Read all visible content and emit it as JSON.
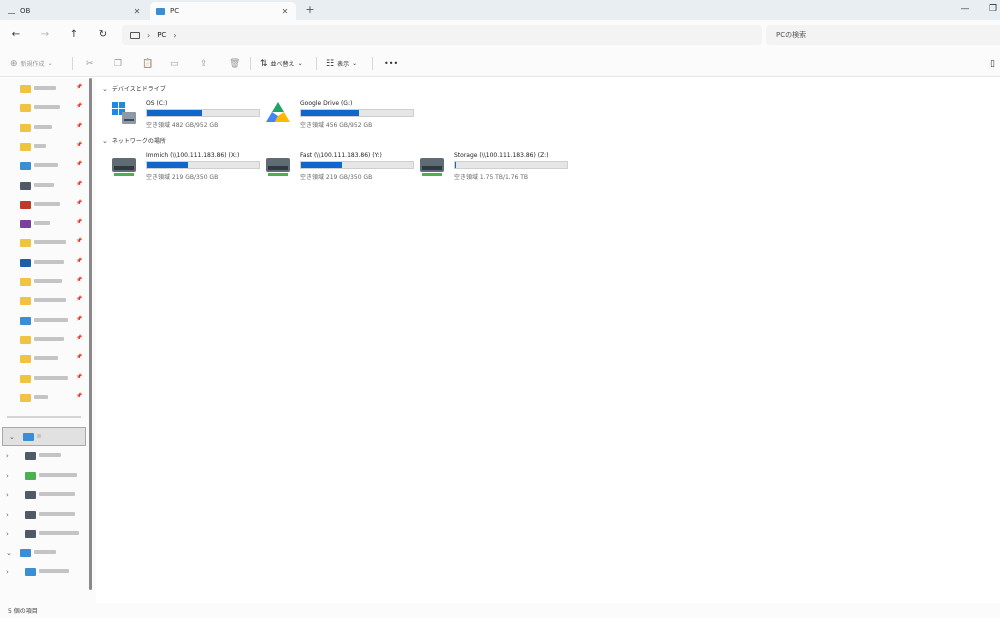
{
  "tabs": [
    {
      "title": "OB"
    },
    {
      "title": "PC"
    }
  ],
  "window": {
    "close_tab": "✕",
    "new_tab": "+",
    "minimize": "—",
    "maximize": "❐"
  },
  "address": {
    "computer_icon": "computer-icon",
    "separator": "›",
    "crumbs": [
      "PC"
    ],
    "search_placeholder": "PCの検索"
  },
  "commandbar": {
    "new_label": "新規作成",
    "sort_label": "並べ替え",
    "view_label": "表示",
    "more_label": "•••"
  },
  "navigation": {
    "quick_access": [
      {
        "color": "#f0c343"
      },
      {
        "color": "#f0c343"
      },
      {
        "color": "#f0c343"
      },
      {
        "color": "#f0c343"
      },
      {
        "color": "#3b8ed4"
      },
      {
        "color": "#505a66"
      },
      {
        "color": "#c0392b"
      },
      {
        "color": "#7b3fa0"
      },
      {
        "color": "#f0c343"
      },
      {
        "color": "#1d5fa8"
      },
      {
        "color": "#f0c343"
      },
      {
        "color": "#f0c343"
      },
      {
        "color": "#3b8ed4"
      },
      {
        "color": "#f0c343"
      },
      {
        "color": "#f0c343"
      },
      {
        "color": "#f0c343"
      },
      {
        "color": "#f0c343"
      }
    ],
    "this_pc": {
      "color": "#3b8ed4"
    },
    "network_drives": [
      {
        "color": "#505a66"
      },
      {
        "color": "#4caf50"
      },
      {
        "color": "#505a66"
      },
      {
        "color": "#505a66"
      },
      {
        "color": "#505a66"
      }
    ],
    "network": {
      "color": "#3b8ed4"
    },
    "network_child": {
      "color": "#3b8ed4"
    }
  },
  "content": {
    "devices_header": "デバイスとドライブ",
    "devices": [
      {
        "name": "OS (C:)",
        "free": "空き領域 482 GB/952 GB",
        "used_fraction": 0.49,
        "icon": "windows-drive-icon"
      },
      {
        "name": "Google Drive (G:)",
        "free": "空き領域 456 GB/952 GB",
        "used_fraction": 0.52,
        "icon": "google-drive-icon"
      }
    ],
    "network_header": "ネットワークの場所",
    "network_locations": [
      {
        "name": "Immich (\\\\100.111.183.86) (X:)",
        "free": "空き領域 219 GB/350 GB",
        "used_fraction": 0.37
      },
      {
        "name": "Fast (\\\\100.111.183.86) (Y:)",
        "free": "空き領域 219 GB/350 GB",
        "used_fraction": 0.37
      },
      {
        "name": "Storage (\\\\100.111.183.86) (Z:)",
        "free": "空き領域 1.75 TB/1.76 TB",
        "used_fraction": 0.01
      }
    ]
  },
  "status": {
    "item_count": "5 個の項目"
  }
}
